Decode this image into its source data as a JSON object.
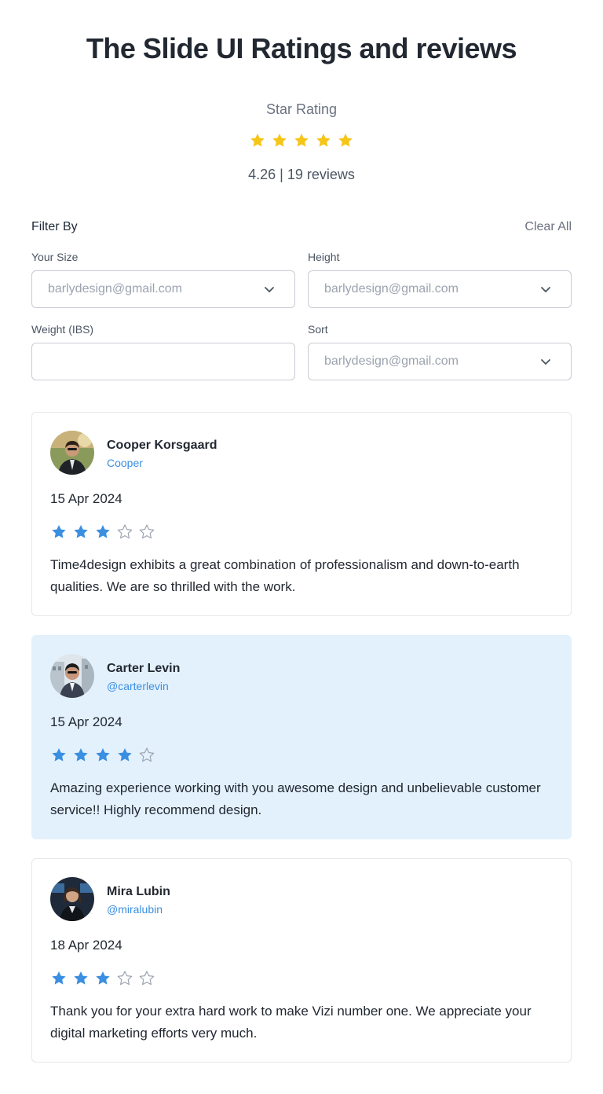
{
  "title": "The Slide UI Ratings and reviews",
  "summary": {
    "label": "Star Rating",
    "stars": 5,
    "score_text": "4.26 | 19 reviews",
    "star_color": "#f5c518"
  },
  "filter": {
    "title": "Filter By",
    "clear_label": "Clear All",
    "fields": {
      "size": {
        "label": "Your Size",
        "value": "barlydesign@gmail.com"
      },
      "height": {
        "label": "Height",
        "value": "barlydesign@gmail.com"
      },
      "weight": {
        "label": "Weight (IBS)",
        "value": ""
      },
      "sort": {
        "label": "Sort",
        "value": "barlydesign@gmail.com"
      }
    }
  },
  "reviews": [
    {
      "name": "Cooper Korsgaard",
      "handle": "Cooper",
      "date": "15 Apr 2024",
      "rating": 3,
      "text": "Time4design exhibits a great combination of professionalism and down-to-earth qualities. We are so thrilled with the work."
    },
    {
      "name": "Carter Levin",
      "handle": "@carterlevin",
      "date": "15 Apr 2024",
      "rating": 4,
      "text": "Amazing experience working with you awesome design and unbelievable customer service!! Highly recommend design."
    },
    {
      "name": "Mira Lubin",
      "handle": "@miralubin",
      "date": "18 Apr 2024",
      "rating": 3,
      "text": "Thank you for your extra hard work to make Vizi number one. We appreciate your digital marketing efforts very much."
    }
  ],
  "colors": {
    "rating_star": "#3b8fe0",
    "empty_star": "#9ca3af",
    "highlight_card": "#e3f1fd"
  }
}
